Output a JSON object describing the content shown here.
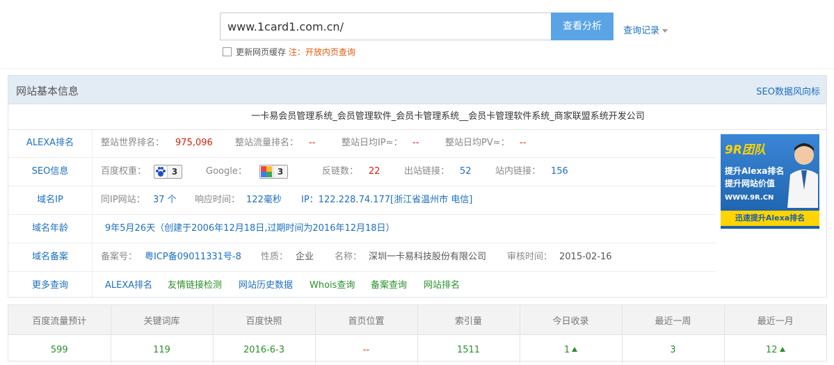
{
  "search": {
    "value": "www.1card1.com.cn/",
    "button_label": "查看分析",
    "history_label": "查询记录"
  },
  "cache": {
    "label": "更新网页缓存",
    "note": "注：开放内页查询"
  },
  "panel": {
    "title": "网站基本信息",
    "link": "SEO数据风向标",
    "site_title": "一卡易会员管理系统_会员管理软件_会员卡管理系统__会员卡管理软件系统_商家联盟系统开发公司",
    "alexa": {
      "label": "ALEXA排名",
      "world_k": "整站世界排名：",
      "world_v": "975,096",
      "traffic_k": "整站流量排名：",
      "traffic_v": "--",
      "ip_k": "整站日均IP≈：",
      "ip_v": "--",
      "pv_k": "整站日均PV≈：",
      "pv_v": "--"
    },
    "seo": {
      "label": "SEO信息",
      "baidu_k": "百度权重：",
      "baidu_v": "3",
      "google_k": "Google：",
      "google_v": "3",
      "backlink_k": "反链数：",
      "backlink_v": "22",
      "outlink_k": "出站链接：",
      "outlink_v": "52",
      "inlink_k": "站内链接：",
      "inlink_v": "156"
    },
    "ip": {
      "label": "域名IP",
      "sameip_k": "同IP网站：",
      "sameip_v": "37 个",
      "resp_k": "响应时间：",
      "resp_v": "122毫秒",
      "ip_v": "IP：122.228.74.177[浙江省温州市 电信]"
    },
    "age": {
      "label": "域名年龄",
      "value": "9年5月26天（创建于2006年12月18日,过期时间为2016年12月18日）"
    },
    "beian": {
      "label": "域名备案",
      "no_k": "备案号：",
      "no_v": "粤ICP备09011331号-8",
      "type_k": "性质：",
      "type_v": "企业",
      "name_k": "名称：",
      "name_v": "深圳一卡易科技股份有限公司",
      "date_k": "审核时间：",
      "date_v": "2015-02-16"
    },
    "more": {
      "label": "更多查询",
      "links": [
        "ALEXA排名",
        "友情链接检测",
        "网站历史数据",
        "Whois查询",
        "备案查询",
        "网站排名"
      ]
    }
  },
  "ad": {
    "brand": "9R团队",
    "line1": "提升Alexa排名",
    "line2": "提升网站价值",
    "url": "WWW.9R.CN",
    "bottom": "迅速提升Alexa排名"
  },
  "stats": {
    "headers": [
      "百度流量预计",
      "关键词库",
      "百度快照",
      "首页位置",
      "索引量",
      "今日收录",
      "最近一周",
      "最近一月"
    ],
    "values": [
      "599",
      "119",
      "2016-6-3",
      "--",
      "1511",
      "1",
      "3",
      "12"
    ]
  },
  "colors": {
    "accent": "#5aa4e6",
    "link": "#1b6fc1",
    "red": "#d81e06",
    "green": "#2a8f2a",
    "panel_head": "#e3ebf5"
  },
  "icons": [
    "baidu-paw-icon",
    "google-icon",
    "caret-down-icon",
    "arrow-up-icon"
  ]
}
